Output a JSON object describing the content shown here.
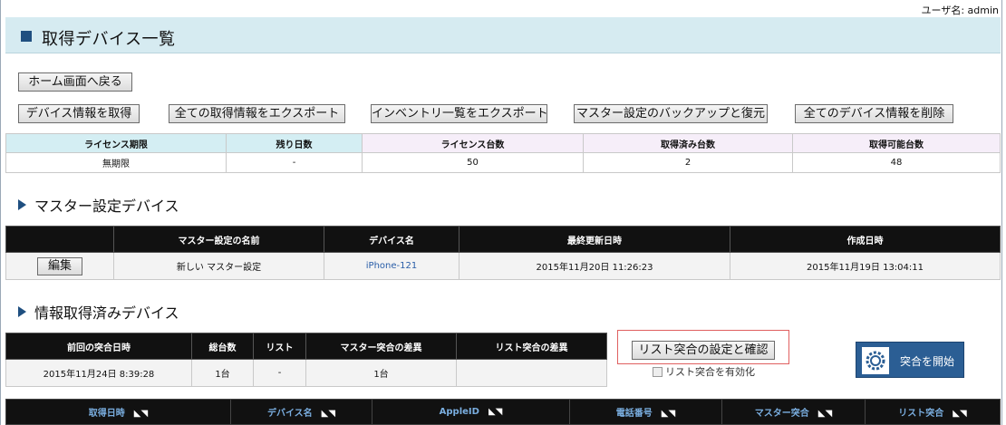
{
  "user": "ユーザ名: admin",
  "title": "取得デバイス一覧",
  "buttons": {
    "home": "ホーム画面へ戻る",
    "get_device": "デバイス情報を取得",
    "export_all": "全ての取得情報をエクスポート",
    "export_inventory": "インベントリ一覧をエクスポート",
    "backup": "マスター設定のバックアップと復元",
    "delete_all": "全てのデバイス情報を削除",
    "edit": "編集",
    "list_settings": "リスト突合の設定と確認",
    "start": "突合を開始"
  },
  "license": {
    "headers": [
      "ライセンス期限",
      "残り日数",
      "ライセンス台数",
      "取得済み台数",
      "取得可能台数"
    ],
    "values": [
      "無期限",
      "-",
      "50",
      "2",
      "48"
    ]
  },
  "master": {
    "section": "マスター設定デバイス",
    "headers": [
      "",
      "マスター設定の名前",
      "デバイス名",
      "最終更新日時",
      "作成日時"
    ],
    "row": [
      "",
      "新しい マスター設定",
      "iPhone-121",
      "2015年11月20日 11:26:23",
      "2015年11月19日 13:04:11"
    ]
  },
  "acquired": {
    "section": "情報取得済みデバイス",
    "headers": [
      "前回の突合日時",
      "総台数",
      "リスト",
      "マスター突合の差異",
      "リスト突合の差異"
    ],
    "row": [
      "2015年11月24日 8:39:28",
      "1台",
      "-",
      "1台",
      ""
    ],
    "checkbox": "リスト突合を有効化"
  },
  "device_table": {
    "headers": [
      "取得日時",
      "デバイス名",
      "AppleID",
      "電話番号",
      "マスター突合",
      "リスト突合"
    ]
  },
  "colors": {
    "accent": "#1f4f80",
    "title_bg": "#d6ebf1",
    "dark": "#111111",
    "button": "#2b5e94"
  }
}
